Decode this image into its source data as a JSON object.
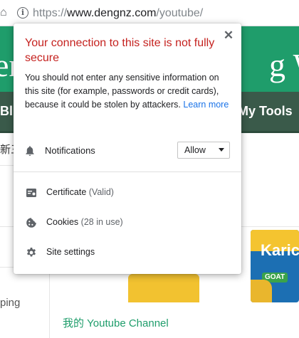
{
  "browser": {
    "url_scheme": "https://",
    "url_host": "www.dengnz.com",
    "url_path": "/youtube/"
  },
  "page": {
    "header_left": "en",
    "header_right": "g W",
    "nav_left": "Bl",
    "nav_right": "My Tools",
    "left_text": "新三",
    "sidebar_item": "ping",
    "product_logo": "Karic",
    "product_badge": "GOAT",
    "youtube_link": "我的 Youtube Channel",
    "header_color": "#1f9d6b",
    "nav_color": "#3a5a4a"
  },
  "popup": {
    "title": "Your connection to this site is not fully secure",
    "description": "You should not enter any sensitive information on this site (for example, passwords or credit cards), because it could be stolen by attackers.",
    "learn_more": "Learn more",
    "notifications_label": "Notifications",
    "notifications_value": "Allow",
    "items": [
      {
        "label": "Certificate",
        "sub": "(Valid)",
        "icon": "certificate-icon"
      },
      {
        "label": "Cookies",
        "sub": "(28 in use)",
        "icon": "cookie-icon"
      },
      {
        "label": "Site settings",
        "sub": "",
        "icon": "gear-icon"
      }
    ],
    "title_color": "#c5221f",
    "link_color": "#1a73e8"
  }
}
